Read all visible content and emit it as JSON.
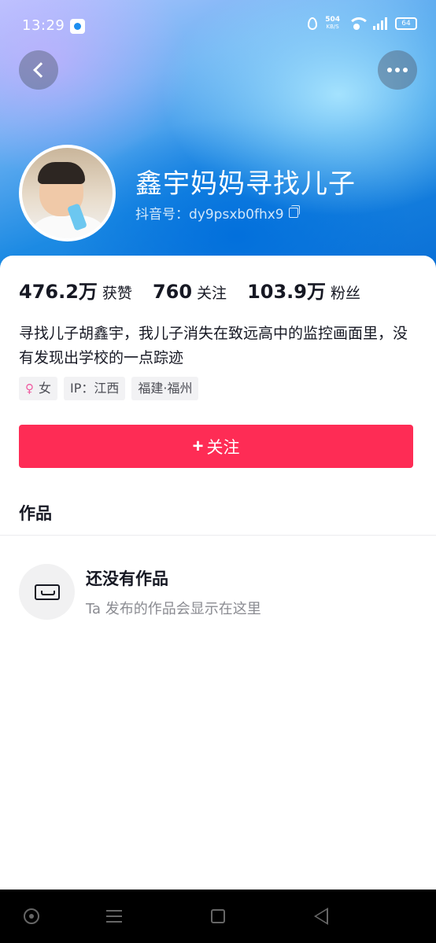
{
  "status_bar": {
    "time": "13:29",
    "net_speed_value": "504",
    "net_speed_unit": "KB/S",
    "network": "4G",
    "battery": "64"
  },
  "profile": {
    "nickname": "鑫宇妈妈寻找儿子",
    "douyin_id": "抖音号：dy9psxb0fhx9",
    "stats": [
      {
        "value": "476.2万",
        "label": "获赞"
      },
      {
        "value": "760",
        "label": "关注"
      },
      {
        "value": "103.9万",
        "label": "粉丝"
      }
    ],
    "bio": "寻找儿子胡鑫宇，我儿子消失在致远高中的监控画面里，没有发现出学校的一点踪迹",
    "tags": [
      {
        "icon": "female-icon",
        "text": "女"
      },
      {
        "text": "IP：江西"
      },
      {
        "text": "福建·福州"
      }
    ],
    "follow_label": "关注",
    "follow_plus": "+"
  },
  "works": {
    "title": "作品",
    "empty_title": "还没有作品",
    "empty_subtitle": "Ta 发布的作品会显示在这里"
  },
  "icons": {
    "back": "chevron-left-icon",
    "more": "more-dots-icon",
    "copy": "copy-icon",
    "empty": "inbox-tray-icon"
  },
  "colors": {
    "accent": "#fe2c55",
    "header_blue": "#1c8ae3",
    "female_pink": "#f05aa0"
  }
}
